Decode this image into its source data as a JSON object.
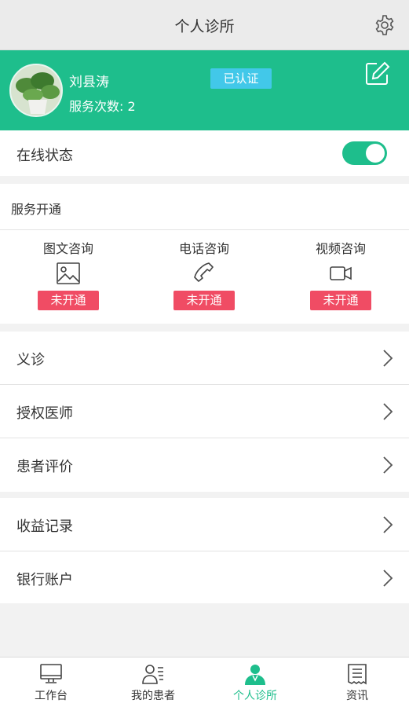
{
  "header": {
    "title": "个人诊所"
  },
  "profile": {
    "name": "刘县涛",
    "service_count": "服务次数: 2",
    "badge": "已认证"
  },
  "online": {
    "label": "在线状态",
    "enabled": true
  },
  "services": {
    "title": "服务开通",
    "items": [
      {
        "label": "图文咨询",
        "status": "未开通",
        "icon": "image-icon"
      },
      {
        "label": "电话咨询",
        "status": "未开通",
        "icon": "phone-icon"
      },
      {
        "label": "视频咨询",
        "status": "未开通",
        "icon": "video-icon"
      }
    ]
  },
  "menu_group1": [
    {
      "label": "义诊"
    },
    {
      "label": "授权医师"
    },
    {
      "label": "患者评价"
    }
  ],
  "menu_group2": [
    {
      "label": "收益记录"
    },
    {
      "label": "银行账户"
    }
  ],
  "tabs": [
    {
      "label": "工作台",
      "icon": "monitor-icon"
    },
    {
      "label": "我的患者",
      "icon": "patients-icon"
    },
    {
      "label": "个人诊所",
      "icon": "doctor-icon",
      "active": true
    },
    {
      "label": "资讯",
      "icon": "news-icon"
    }
  ],
  "colors": {
    "accent": "#1ebe8c",
    "badge": "#42c8e9",
    "status_off": "#f04c64",
    "header_bg": "#ebebeb"
  }
}
